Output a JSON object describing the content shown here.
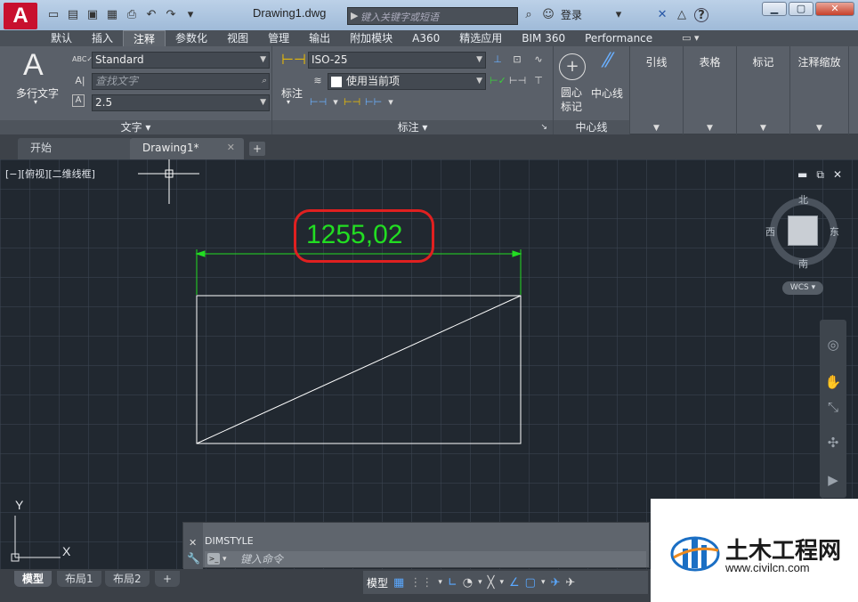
{
  "app": {
    "logo": "A",
    "document_title": "Drawing1.dwg"
  },
  "search": {
    "placeholder": "键入关键字或短语"
  },
  "title_bar": {
    "login_label": "登录",
    "help_label": "?"
  },
  "ribbon_tabs": [
    "默认",
    "插入",
    "注释",
    "参数化",
    "视图",
    "管理",
    "输出",
    "附加模块",
    "A360",
    "精选应用",
    "BIM 360",
    "Performance"
  ],
  "active_ribbon_tab": "注释",
  "text_panel": {
    "big_button_label": "多行文字",
    "style_value": "Standard",
    "find_placeholder": "查找文字",
    "height_value": "2.5",
    "footer": "文字"
  },
  "dimension_panel": {
    "big_button_label": "标注",
    "style_value": "ISO-25",
    "layer_value": "使用当前项",
    "footer": "标注"
  },
  "centerline_panel": {
    "center_mark_label": "圆心\n标记",
    "centerline_label": "中心线",
    "footer": "中心线"
  },
  "right_panels": [
    "引线",
    "表格",
    "标记",
    "注释缩放"
  ],
  "file_tabs": [
    {
      "label": "开始"
    },
    {
      "label": "Drawing1*"
    }
  ],
  "viewport": {
    "label": "[−][俯视][二维线框]",
    "dimension_text": "1255,02",
    "compass": {
      "north": "北",
      "south": "南",
      "east": "东",
      "west": "西"
    },
    "wcs_label": "WCS",
    "ucs": {
      "x": "X",
      "y": "Y"
    }
  },
  "command_line": {
    "history": "DIMSTYLE",
    "placeholder": "键入命令"
  },
  "layout_tabs": [
    "模型",
    "布局1",
    "布局2"
  ],
  "status": {
    "model_label": "模型"
  },
  "watermark": {
    "title": "土木工程网",
    "url": "www.civilcn.com"
  },
  "colors": {
    "canvas_bg": "#212830",
    "dimension_green": "#22dd22",
    "highlight_red": "#e02020",
    "ribbon_bg": "#5a6069",
    "autocad_red": "#c8102e"
  }
}
